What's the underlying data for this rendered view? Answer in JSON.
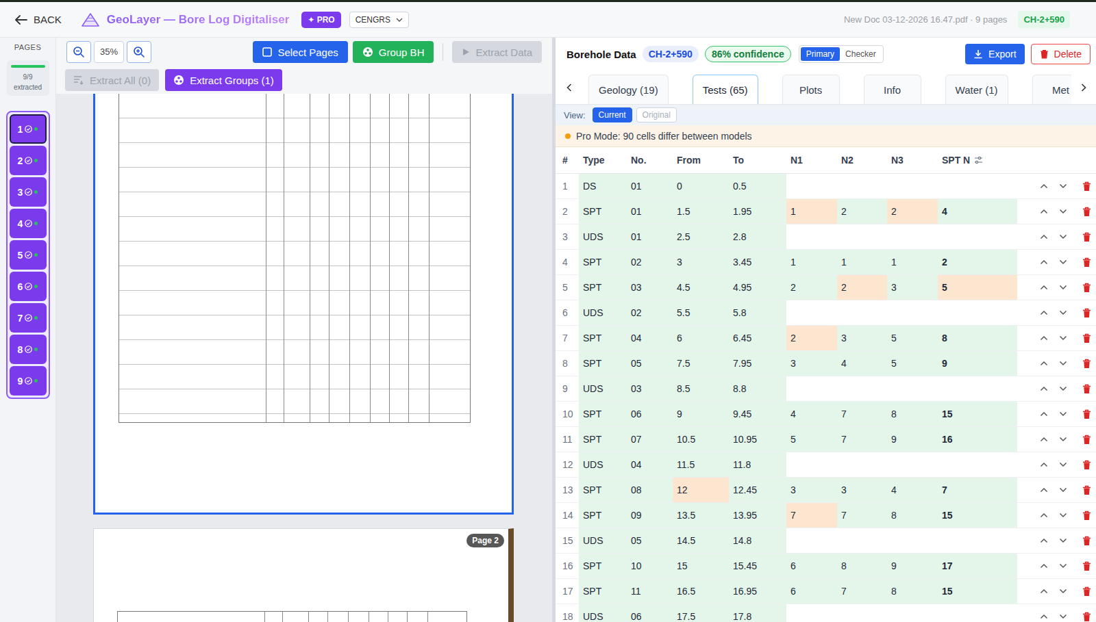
{
  "header": {
    "back": "BACK",
    "title": "GeoLayer — Bore Log Digitaliser",
    "pro_badge": "✦ PRO",
    "org": "CENGRS",
    "file": "New Doc 03-12-2026 16.47.pdf · 9 pages",
    "borehole": "CH-2+590"
  },
  "pages_sidebar": {
    "title": "PAGES",
    "level": 1,
    "count": "9/9",
    "count_label": "extracted",
    "pages": [
      {
        "label": "1",
        "selected": true,
        "extracted": true
      },
      {
        "label": "2",
        "selected": false,
        "extracted": true
      },
      {
        "label": "3",
        "selected": false,
        "extracted": true
      },
      {
        "label": "4",
        "selected": false,
        "extracted": true
      },
      {
        "label": "5",
        "selected": false,
        "extracted": true
      },
      {
        "label": "6",
        "selected": false,
        "extracted": true
      },
      {
        "label": "7",
        "selected": false,
        "extracted": true
      },
      {
        "label": "8",
        "selected": false,
        "extracted": true
      },
      {
        "label": "9",
        "selected": false,
        "extracted": true
      }
    ]
  },
  "toolbar": {
    "zoom": "35%",
    "select_pages": "Select Pages",
    "group_bh": "Group BH",
    "extract_data": {
      "label": "Extract Data",
      "disabled": true
    },
    "extract_all": {
      "label": "Extract All (0)",
      "disabled": true
    },
    "extract_groups": {
      "label": "Extract Groups (1)",
      "disabled": false
    }
  },
  "viewer": {
    "pages": [
      {
        "badge": "",
        "selected": true
      },
      {
        "badge": "Page 2",
        "selected": false
      }
    ]
  },
  "panel": {
    "title": "Borehole Data",
    "borehole": "CH-2+590",
    "confidence": "86% confidence",
    "modes": [
      {
        "label": "Primary",
        "selected": true
      },
      {
        "label": "Checker",
        "selected": false
      }
    ],
    "export": "Export",
    "delete": "Delete",
    "tabs": [
      {
        "label": "Geology (19)",
        "selected": false
      },
      {
        "label": "Tests (65)",
        "selected": true
      },
      {
        "label": "Plots",
        "selected": false
      },
      {
        "label": "Info",
        "selected": false
      },
      {
        "label": "Water (1)",
        "selected": false
      },
      {
        "label": "Met",
        "selected": false
      }
    ],
    "view": {
      "label": "View:",
      "options": [
        {
          "label": "Current",
          "selected": true
        },
        {
          "label": "Original",
          "selected": false
        }
      ]
    },
    "banner": "Pro Mode: 90 cells differ between models"
  },
  "table": {
    "columns": [
      "#",
      "Type",
      "No.",
      "From",
      "To",
      "N1",
      "N2",
      "N3",
      "SPT N"
    ],
    "rows": [
      {
        "cells": [
          "1",
          "DS",
          "01",
          "0",
          "0.5",
          "",
          "",
          "",
          ""
        ],
        "diff": []
      },
      {
        "cells": [
          "2",
          "SPT",
          "01",
          "1.5",
          "1.95",
          "1",
          "2",
          "2",
          "4"
        ],
        "diff": [
          "N1",
          "N3"
        ]
      },
      {
        "cells": [
          "3",
          "UDS",
          "01",
          "2.5",
          "2.8",
          "",
          "",
          "",
          ""
        ],
        "diff": []
      },
      {
        "cells": [
          "4",
          "SPT",
          "02",
          "3",
          "3.45",
          "1",
          "1",
          "1",
          "2"
        ],
        "diff": []
      },
      {
        "cells": [
          "5",
          "SPT",
          "03",
          "4.5",
          "4.95",
          "2",
          "2",
          "3",
          "5"
        ],
        "diff": [
          "N2",
          "SPT N"
        ]
      },
      {
        "cells": [
          "6",
          "UDS",
          "02",
          "5.5",
          "5.8",
          "",
          "",
          "",
          ""
        ],
        "diff": []
      },
      {
        "cells": [
          "7",
          "SPT",
          "04",
          "6",
          "6.45",
          "2",
          "3",
          "5",
          "8"
        ],
        "diff": [
          "N1"
        ]
      },
      {
        "cells": [
          "8",
          "SPT",
          "05",
          "7.5",
          "7.95",
          "3",
          "4",
          "5",
          "9"
        ],
        "diff": []
      },
      {
        "cells": [
          "9",
          "UDS",
          "03",
          "8.5",
          "8.8",
          "",
          "",
          "",
          ""
        ],
        "diff": []
      },
      {
        "cells": [
          "10",
          "SPT",
          "06",
          "9",
          "9.45",
          "4",
          "7",
          "8",
          "15"
        ],
        "diff": []
      },
      {
        "cells": [
          "11",
          "SPT",
          "07",
          "10.5",
          "10.95",
          "5",
          "7",
          "9",
          "16"
        ],
        "diff": []
      },
      {
        "cells": [
          "12",
          "UDS",
          "04",
          "11.5",
          "11.8",
          "",
          "",
          "",
          ""
        ],
        "diff": []
      },
      {
        "cells": [
          "13",
          "SPT",
          "08",
          "12",
          "12.45",
          "3",
          "3",
          "4",
          "7"
        ],
        "diff": [
          "From"
        ]
      },
      {
        "cells": [
          "14",
          "SPT",
          "09",
          "13.5",
          "13.95",
          "7",
          "7",
          "8",
          "15"
        ],
        "diff": [
          "N1"
        ]
      },
      {
        "cells": [
          "15",
          "UDS",
          "05",
          "14.5",
          "14.8",
          "",
          "",
          "",
          ""
        ],
        "diff": []
      },
      {
        "cells": [
          "16",
          "SPT",
          "10",
          "15",
          "15.45",
          "6",
          "8",
          "9",
          "17"
        ],
        "diff": []
      },
      {
        "cells": [
          "17",
          "SPT",
          "11",
          "16.5",
          "16.95",
          "6",
          "7",
          "8",
          "15"
        ],
        "diff": []
      },
      {
        "cells": [
          "18",
          "UDS",
          "06",
          "17.5",
          "17.8",
          "",
          "",
          "",
          ""
        ],
        "diff": []
      }
    ]
  }
}
